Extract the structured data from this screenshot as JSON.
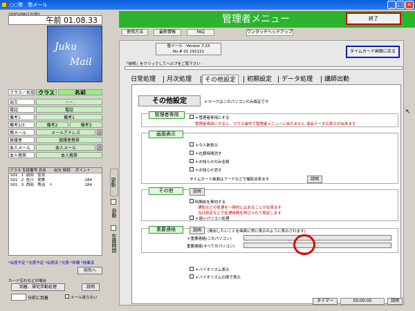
{
  "window": {
    "title": "○○塾　塾メール",
    "min": "_",
    "max": "□",
    "close": "×"
  },
  "left": {
    "date": "2005/08/12(金)",
    "clock": "午前 01.08.33",
    "logo": {
      "line1": "Juku",
      "line2": "Mail"
    },
    "rows": [
      {
        "label": "クラス／名前",
        "value1": "クラス",
        "value2": "名前"
      },
      {
        "label": "出欠",
        "value": "－－"
      },
      {
        "label": "電話",
        "value": "電話"
      },
      {
        "label": "備考1",
        "value": "備考1"
      },
      {
        "label": "備考2/3",
        "value1": "備考2",
        "value2": "備考3"
      },
      {
        "label": "親メール",
        "value": "メールアドレス"
      },
      {
        "label": "保護者",
        "value": "保護者携帯"
      },
      {
        "label": "本人メール",
        "value": "本人メール"
      },
      {
        "label": "本人携帯",
        "value": "本人携帯"
      }
    ],
    "list_header": "クラス 生徒番号 氏名　　出欠 時刻　 ポイント",
    "students": [
      {
        "cls": "S01",
        "no": "1",
        "name": "前田　佳奈",
        "pt": ""
      },
      {
        "cls": "S01",
        "no": "2",
        "name": "佐川　栄美",
        "pt": "184"
      },
      {
        "cls": "S01",
        "no": "3",
        "name": "西田　秀治　＋",
        "pt": "184"
      }
    ],
    "side_tabs": [
      "更新",
      "自動",
      "在籍時間"
    ],
    "footer_text": "*出席予定 *欠席予定 *出席済 *欠席 *休講 *授業済",
    "footer_btn": "宛先へ",
    "note_label": "カード忘れなどの場合",
    "manual_btn": "到着、帰宅手動処理",
    "help_btn": "説明",
    "minutes_label": "分前に到着",
    "no_mail": "メール送らない"
  },
  "header": {
    "title": "管理者メニュー",
    "exit": "終了",
    "menu": [
      "使用方法",
      "最新情報",
      "FAQ",
      "ワンタッチヘッドアップ"
    ]
  },
  "version": {
    "line1": "塾メール　Version 7.23",
    "line2": "No.# 01 191121"
  },
  "timecard_btn": "タイムカード画面に戻る",
  "hint": "「説明」をクリックしてヘルプをご覧下さい",
  "tabs": [
    "日常処理",
    "月次処理",
    "その他設定",
    "初期設定",
    "データ処理",
    "講師出勤"
  ],
  "selected_tab": 2,
  "section": {
    "title": "その他設定",
    "note": "＊マークはこのパソコンのみ設定です",
    "groups": {
      "admin": {
        "label": "管理者専用",
        "opt": "＊管理者専用にする",
        "red": "管理者専用にすると、マウス操作で管理者メニューに戻れません 退会データの表示が出来ます"
      },
      "display": {
        "label": "画面表示",
        "opts": [
          "＊今人数表示",
          "＊在籍時間消す",
          "＊お知らせのみ全面",
          "＊お知らせ消す"
        ],
        "timecard": "タイムカード画面はフードなどで撮影出来ます",
        "btn": "説明"
      },
      "other": {
        "label": "その他",
        "btn": "説明",
        "opt": "時間前を無効する",
        "red1": "通知などの処理を一時的に止めることが出来ます",
        "red2": "当日設定などで処理時間を再び入れて設定します",
        "opt2": "＊遅いパソコン処理"
      },
      "urgent": {
        "label": "重要連絡",
        "btn": "説明",
        "desc": "(掲出したいことを画面に常に表示のように表示されます)",
        "f1": "＊重要連絡(このパソコン)",
        "f2": "重要連絡(すべてのパソコン)"
      },
      "biorhythm": {
        "opt1": "＊バイオリズム表示",
        "opt2": "＊バイオリズムの面で表示"
      }
    }
  },
  "status": {
    "timer_label": "タイマー",
    "timer": "00:00:00",
    "help": "説明"
  }
}
